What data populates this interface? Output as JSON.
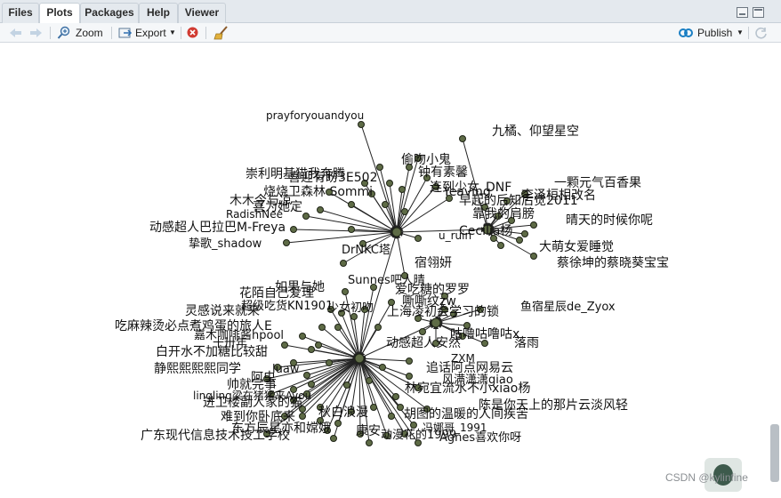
{
  "tabs": [
    {
      "label": "Files",
      "active": false
    },
    {
      "label": "Plots",
      "active": true
    },
    {
      "label": "Packages",
      "active": false
    },
    {
      "label": "Help",
      "active": false
    },
    {
      "label": "Viewer",
      "active": false
    }
  ],
  "toolbar": {
    "zoom_label": "Zoom",
    "export_label": "Export",
    "publish_label": "Publish"
  },
  "watermark": "CSDN @kylinfine",
  "colors": {
    "node_fill": "#5e6b46",
    "node_stroke": "#1f2417",
    "edge": "#222222",
    "toolbar_bg": "#f5f7f9",
    "tabbar_bg": "#e4e9ee",
    "publish_icon": "#1a7fc4",
    "stop_icon": "#d13b32"
  },
  "graph": {
    "hubs": [
      "hub1",
      "hub2",
      "hub3",
      "hub4"
    ],
    "labels": [
      {
        "text": "prayforyouandyou"
      },
      {
        "text": "九橘、仰望星空"
      },
      {
        "text": "偷吻小鬼"
      },
      {
        "text": "钟有素馨"
      },
      {
        "text": "崇利明基猫我奔腾"
      },
      {
        "text": "喜迎有盼3E502"
      },
      {
        "text": "一颗元气百香果"
      },
      {
        "text": "连到少女_DNF"
      },
      {
        "text": "Yeaving"
      },
      {
        "text": "李泽桓相改名"
      },
      {
        "text": "早起的后知后觉2011"
      },
      {
        "text": "烧烧卫森林 Sommi"
      },
      {
        "text": "木木今与凉"
      },
      {
        "text": "喜为她定"
      },
      {
        "text": "靠我的肩膀"
      },
      {
        "text": "晴天的时候你呢"
      },
      {
        "text": "RadishNee"
      },
      {
        "text": "动感超人巴拉巴M-Freya"
      },
      {
        "text": "Cecilia杨"
      },
      {
        "text": "u_ruin"
      },
      {
        "text": "挚歌_shadow"
      },
      {
        "text": "大萌女爱睡觉"
      },
      {
        "text": "DrNKC塔"
      },
      {
        "text": "蔡徐坤的蔡晓葵宝宝"
      },
      {
        "text": "宿翎妍"
      },
      {
        "text": "Sunnes吧人晴"
      },
      {
        "text": "如果与她"
      },
      {
        "text": "爱吃糖的罗罗"
      },
      {
        "text": "花陌自己爱理"
      },
      {
        "text": "嘶嘶纹zw"
      },
      {
        "text": "鱼宿星辰de_Zyox"
      },
      {
        "text": "灵感说来就来"
      },
      {
        "text": "超级吃货KN1901"
      },
      {
        "text": "少女初吻"
      },
      {
        "text": "上海凌初会学习的锁"
      },
      {
        "text": "吃麻辣烫必点煮鸡蛋的旅人E"
      },
      {
        "text": "嘉木咖啡酱hpool"
      },
      {
        "text": "咕噜咕噜咕x"
      },
      {
        "text": "十卅年"
      },
      {
        "text": "动感超人安然"
      },
      {
        "text": "落雨"
      },
      {
        "text": "白开水不加糖比较甜"
      },
      {
        "text": "ZXM"
      },
      {
        "text": "静熙熙熙熙同学"
      },
      {
        "text": "luaw"
      },
      {
        "text": "追话阿点网易云"
      },
      {
        "text": "帅就完事"
      },
      {
        "text": "风满潇潇giao"
      },
      {
        "text": "阿虫"
      },
      {
        "text": "lingling梁在猪猪来Ayou"
      },
      {
        "text": "林宛宜流水不小xiao杨"
      },
      {
        "text": "进卫楼副人家的猫"
      },
      {
        "text": "陈是你天上的那片云淡风轻"
      },
      {
        "text": "难到你卧底来"
      },
      {
        "text": "胡图的温暖的人间疾苦"
      },
      {
        "text": "秋白浪漫"
      },
      {
        "text": "冯娜哥_1991"
      },
      {
        "text": "东方辰星亦和嫦娥"
      },
      {
        "text": "康安"
      },
      {
        "text": "动漫花的1999"
      },
      {
        "text": "广东现代信息技术技工学校"
      },
      {
        "text": "Agnes喜欢你呀"
      }
    ]
  }
}
